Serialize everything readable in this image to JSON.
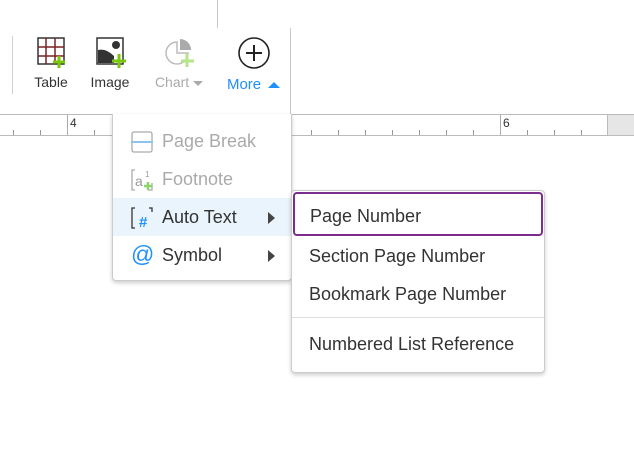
{
  "toolbar": {
    "table_label": "Table",
    "image_label": "Image",
    "chart_label": "Chart",
    "more_label": "More",
    "accent": "#1e90ff"
  },
  "ruler": {
    "labels": [
      "4",
      "6"
    ]
  },
  "more_menu": {
    "items": [
      {
        "label": "Page Break",
        "icon": "page-break-icon",
        "disabled": true
      },
      {
        "label": "Footnote",
        "icon": "footnote-icon",
        "disabled": true
      },
      {
        "label": "Auto Text",
        "icon": "auto-text-icon",
        "submenu": true,
        "highlighted": true
      },
      {
        "label": "Symbol",
        "icon": "at-symbol-icon",
        "submenu": true
      }
    ]
  },
  "auto_text_menu": {
    "items": [
      {
        "label": "Page Number",
        "selected": true,
        "selected_border": "#7b2d8e"
      },
      {
        "label": "Section Page Number"
      },
      {
        "label": "Bookmark Page Number"
      },
      {
        "label": "Numbered List Reference"
      }
    ]
  }
}
